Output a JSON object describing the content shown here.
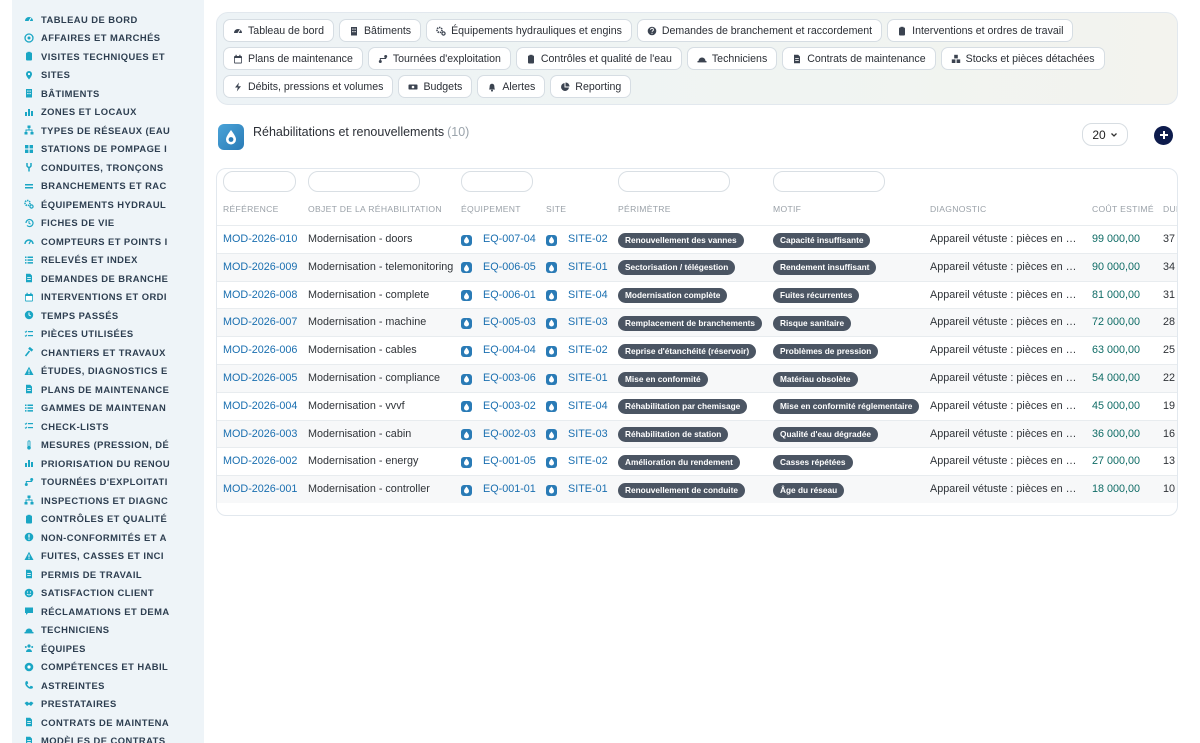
{
  "sidebar": {
    "items": [
      {
        "label": "TABLEAU DE BORD",
        "icon": "dashboard-icon"
      },
      {
        "label": "AFFAIRES ET MARCHÉS",
        "icon": "target-icon"
      },
      {
        "label": "VISITES TECHNIQUES ET",
        "icon": "clipboard-icon"
      },
      {
        "label": "SITES",
        "icon": "map-pin-icon"
      },
      {
        "label": "BÂTIMENTS",
        "icon": "building-icon"
      },
      {
        "label": "ZONES ET LOCAUX",
        "icon": "chart-bars-icon"
      },
      {
        "label": "TYPES DE RÉSEAUX (EAU",
        "icon": "network-icon"
      },
      {
        "label": "STATIONS DE POMPAGE I",
        "icon": "grid-icon"
      },
      {
        "label": "CONDUITES, TRONÇONS",
        "icon": "pipe-icon"
      },
      {
        "label": "BRANCHEMENTS ET RAC",
        "icon": "lines-icon"
      },
      {
        "label": "ÉQUIPEMENTS HYDRAUL",
        "icon": "gears-icon"
      },
      {
        "label": "FICHES DE VIE",
        "icon": "history-icon"
      },
      {
        "label": "COMPTEURS ET POINTS I",
        "icon": "gauge-icon"
      },
      {
        "label": "RELEVÉS ET INDEX",
        "icon": "list-icon"
      },
      {
        "label": "DEMANDES DE BRANCHE",
        "icon": "doc-icon"
      },
      {
        "label": "INTERVENTIONS ET ORDI",
        "icon": "calendar-icon"
      },
      {
        "label": "TEMPS PASSÉS",
        "icon": "clock-icon"
      },
      {
        "label": "PIÈCES UTILISÉES",
        "icon": "checklist-icon"
      },
      {
        "label": "CHANTIERS ET TRAVAUX",
        "icon": "hammer-icon"
      },
      {
        "label": "ÉTUDES, DIAGNOSTICS E",
        "icon": "warning-icon"
      },
      {
        "label": "PLANS DE MAINTENANCE",
        "icon": "doc-icon"
      },
      {
        "label": "GAMMES DE MAINTENAN",
        "icon": "list-icon"
      },
      {
        "label": "CHECK-LISTS",
        "icon": "checklist-icon"
      },
      {
        "label": "MESURES (PRESSION, DÉ",
        "icon": "thermometer-icon"
      },
      {
        "label": "PRIORISATION DU RENOU",
        "icon": "chart-bars-icon"
      },
      {
        "label": "TOURNÉES D'EXPLOITATI",
        "icon": "route-icon"
      },
      {
        "label": "INSPECTIONS ET DIAGNC",
        "icon": "network-icon"
      },
      {
        "label": "CONTRÔLES ET QUALITÉ",
        "icon": "clipboard-icon"
      },
      {
        "label": "NON-CONFORMITÉS ET A",
        "icon": "alert-circle-icon"
      },
      {
        "label": "FUITES, CASSES ET INCI",
        "icon": "warning-icon"
      },
      {
        "label": "PERMIS DE TRAVAIL",
        "icon": "doc-icon"
      },
      {
        "label": "SATISFACTION CLIENT",
        "icon": "smile-icon"
      },
      {
        "label": "RÉCLAMATIONS ET DEMA",
        "icon": "chat-icon"
      },
      {
        "label": "TECHNICIENS",
        "icon": "helmet-icon"
      },
      {
        "label": "ÉQUIPES",
        "icon": "users-icon"
      },
      {
        "label": "COMPÉTENCES ET HABIL",
        "icon": "badge-icon"
      },
      {
        "label": "ASTREINTES",
        "icon": "phone-icon"
      },
      {
        "label": "PRESTATAIRES",
        "icon": "handshake-icon"
      },
      {
        "label": "CONTRATS DE MAINTENA",
        "icon": "doc-icon"
      },
      {
        "label": "MODÈLES DE CONTRATS",
        "icon": "doc-icon"
      }
    ]
  },
  "nav": {
    "rows": [
      [
        {
          "label": "Tableau de bord",
          "icon": "dashboard-icon"
        },
        {
          "label": "Bâtiments",
          "icon": "building-icon"
        },
        {
          "label": "Équipements hydrauliques et engins",
          "icon": "gears-icon"
        },
        {
          "label": "Demandes de branchement et raccordement",
          "icon": "question-icon"
        },
        {
          "label": "Interventions et ordres de travail",
          "icon": "clipboard-icon"
        }
      ],
      [
        {
          "label": "Plans de maintenance",
          "icon": "calendar-icon"
        },
        {
          "label": "Tournées d'exploitation",
          "icon": "route-icon"
        },
        {
          "label": "Contrôles et qualité de l'eau",
          "icon": "clipboard-icon"
        },
        {
          "label": "Techniciens",
          "icon": "helmet-icon"
        },
        {
          "label": "Contrats de maintenance",
          "icon": "doc-icon"
        },
        {
          "label": "Stocks et pièces détachées",
          "icon": "boxes-icon"
        }
      ],
      [
        {
          "label": "Débits, pressions et volumes",
          "icon": "bolt-icon"
        },
        {
          "label": "Budgets",
          "icon": "money-icon"
        },
        {
          "label": "Alertes",
          "icon": "bell-icon"
        },
        {
          "label": "Reporting",
          "icon": "pie-icon"
        }
      ]
    ]
  },
  "header": {
    "title": "Réhabilitations et renouvellements",
    "count": "(10)",
    "page_size": "20"
  },
  "table": {
    "columns": {
      "reference": "RÉFÉRENCE",
      "objet": "OBJET DE LA RÉHABILITATION",
      "equipement": "ÉQUIPEMENT",
      "site": "SITE",
      "perimetre": "PÉRIMÈTRE",
      "motif": "MOTIF",
      "diagnostic": "DIAGNOSTIC",
      "cout": "COÛT ESTIMÉ",
      "duree": "DUF"
    },
    "rows": [
      {
        "reference": "MOD-2026-010",
        "objet": "Modernisation - doors",
        "equipement": "EQ-007-04",
        "site": "SITE-02",
        "perimetre": "Renouvellement des vannes",
        "motif": "Capacité insuffisante",
        "diagnostic": "Appareil vétuste : pièces en o…",
        "cout": "99 000,00",
        "duree": "37"
      },
      {
        "reference": "MOD-2026-009",
        "objet": "Modernisation - telemonitoring",
        "equipement": "EQ-006-05",
        "site": "SITE-01",
        "perimetre": "Sectorisation / télégestion",
        "motif": "Rendement insuffisant",
        "diagnostic": "Appareil vétuste : pièces en o…",
        "cout": "90 000,00",
        "duree": "34"
      },
      {
        "reference": "MOD-2026-008",
        "objet": "Modernisation - complete",
        "equipement": "EQ-006-01",
        "site": "SITE-04",
        "perimetre": "Modernisation complète",
        "motif": "Fuites récurrentes",
        "diagnostic": "Appareil vétuste : pièces en o…",
        "cout": "81 000,00",
        "duree": "31"
      },
      {
        "reference": "MOD-2026-007",
        "objet": "Modernisation - machine",
        "equipement": "EQ-005-03",
        "site": "SITE-03",
        "perimetre": "Remplacement de branchements",
        "motif": "Risque sanitaire",
        "diagnostic": "Appareil vétuste : pièces en o…",
        "cout": "72 000,00",
        "duree": "28"
      },
      {
        "reference": "MOD-2026-006",
        "objet": "Modernisation - cables",
        "equipement": "EQ-004-04",
        "site": "SITE-02",
        "perimetre": "Reprise d'étanchéité (réservoir)",
        "motif": "Problèmes de pression",
        "diagnostic": "Appareil vétuste : pièces en o…",
        "cout": "63 000,00",
        "duree": "25"
      },
      {
        "reference": "MOD-2026-005",
        "objet": "Modernisation - compliance",
        "equipement": "EQ-003-06",
        "site": "SITE-01",
        "perimetre": "Mise en conformité",
        "motif": "Matériau obsolète",
        "diagnostic": "Appareil vétuste : pièces en o…",
        "cout": "54 000,00",
        "duree": "22"
      },
      {
        "reference": "MOD-2026-004",
        "objet": "Modernisation - vvvf",
        "equipement": "EQ-003-02",
        "site": "SITE-04",
        "perimetre": "Réhabilitation par chemisage",
        "motif": "Mise en conformité réglementaire",
        "diagnostic": "Appareil vétuste : pièces en o…",
        "cout": "45 000,00",
        "duree": "19"
      },
      {
        "reference": "MOD-2026-003",
        "objet": "Modernisation - cabin",
        "equipement": "EQ-002-03",
        "site": "SITE-03",
        "perimetre": "Réhabilitation de station",
        "motif": "Qualité d'eau dégradée",
        "diagnostic": "Appareil vétuste : pièces en o…",
        "cout": "36 000,00",
        "duree": "16"
      },
      {
        "reference": "MOD-2026-002",
        "objet": "Modernisation - energy",
        "equipement": "EQ-001-05",
        "site": "SITE-02",
        "perimetre": "Amélioration du rendement",
        "motif": "Casses répétées",
        "diagnostic": "Appareil vétuste : pièces en o…",
        "cout": "27 000,00",
        "duree": "13"
      },
      {
        "reference": "MOD-2026-001",
        "objet": "Modernisation - controller",
        "equipement": "EQ-001-01",
        "site": "SITE-01",
        "perimetre": "Renouvellement de conduite",
        "motif": "Âge du réseau",
        "diagnostic": "Appareil vétuste : pièces en o…",
        "cout": "18 000,00",
        "duree": "10"
      }
    ]
  },
  "colors": {
    "sidebar_bg": "#eef4f8",
    "icon_accent": "#1aa6c4",
    "link": "#1a6fb0",
    "money": "#0f6c66",
    "badge_bg": "#4b5563",
    "add_button": "#0d1b4c"
  }
}
